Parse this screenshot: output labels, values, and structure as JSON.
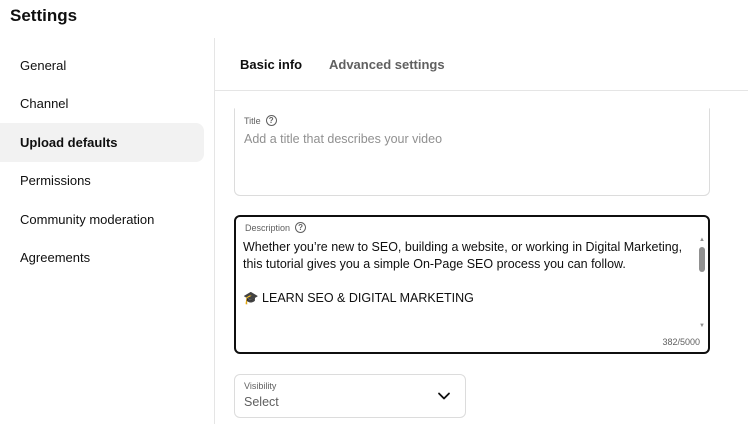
{
  "page": {
    "title": "Settings"
  },
  "sidebar": {
    "items": [
      {
        "label": "General"
      },
      {
        "label": "Channel"
      },
      {
        "label": "Upload defaults",
        "active": true
      },
      {
        "label": "Permissions"
      },
      {
        "label": "Community moderation"
      },
      {
        "label": "Agreements"
      }
    ]
  },
  "tabs": {
    "basic_info": "Basic info",
    "advanced_settings": "Advanced settings"
  },
  "title_field": {
    "label": "Title",
    "help_icon": "?",
    "placeholder": "Add a title that describes your video"
  },
  "description_field": {
    "label": "Description",
    "help_icon": "?",
    "line1": "Whether you’re new to SEO, building a website, or working in Digital Marketing,",
    "line2": "this tutorial gives you a simple On-Page SEO process you can follow.",
    "line3": "",
    "line4": "🎓 LEARN SEO & DIGITAL MARKETING",
    "char_count": "382/5000"
  },
  "visibility_field": {
    "label": "Visibility",
    "value": "Select"
  },
  "icons": {
    "help": "help-circle-icon",
    "chevron": "chevron-down-icon",
    "scroll_up": "scroll-up-arrow-icon",
    "scroll_down": "scroll-down-arrow-icon"
  }
}
